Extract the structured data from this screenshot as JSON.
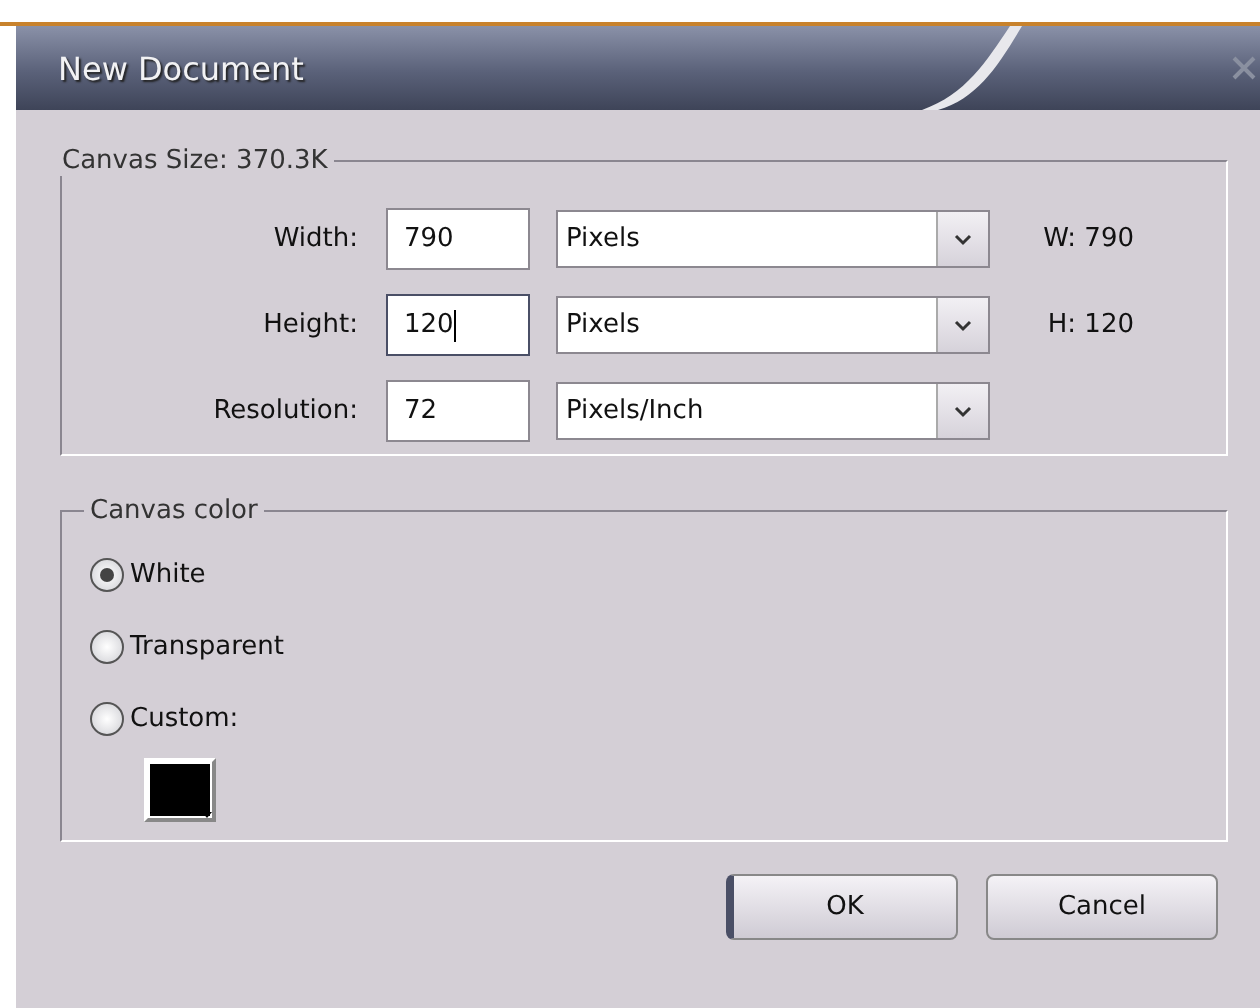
{
  "window": {
    "title": "New Document"
  },
  "canvas_size": {
    "legend": "Canvas Size: 370.3K",
    "rows": [
      {
        "label": "Width:",
        "value": "790",
        "unit": "Pixels",
        "readout": "W: 790",
        "focused": false
      },
      {
        "label": "Height:",
        "value": "120",
        "unit": "Pixels",
        "readout": "H: 120",
        "focused": true
      },
      {
        "label": "Resolution:",
        "value": "72",
        "unit": "Pixels/Inch",
        "focused": false
      }
    ]
  },
  "canvas_color": {
    "legend": "Canvas color",
    "options": [
      {
        "label": "White",
        "selected": true
      },
      {
        "label": "Transparent",
        "selected": false
      },
      {
        "label": "Custom:",
        "selected": false
      }
    ],
    "swatch": {
      "color": "#000000"
    }
  },
  "buttons": [
    {
      "label": "OK",
      "default": true
    },
    {
      "label": "Cancel",
      "default": false
    }
  ]
}
